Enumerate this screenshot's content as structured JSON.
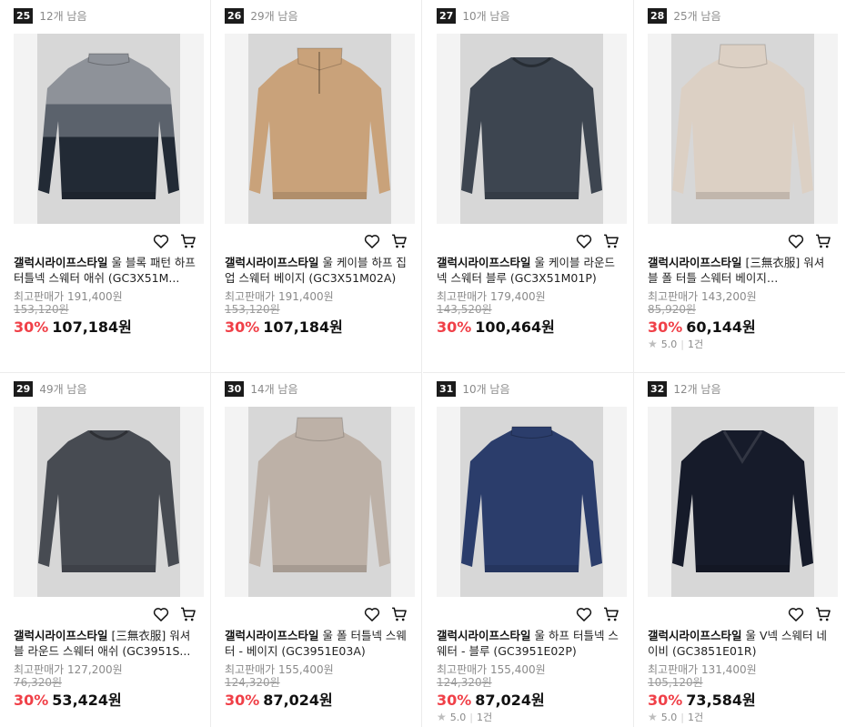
{
  "products": [
    {
      "rank": "25",
      "remaining": "12개 남음",
      "brand": "갤럭시라이프스타일",
      "name": "울 블록 패턴 하프 터틀넥 스웨터 애쉬 (GC3X51M...",
      "max_price": "최고판매가 191,400원",
      "original_price": "153,120원",
      "discount": "30%",
      "price": "107,184원",
      "rating": "",
      "review_count": "",
      "sweater": {
        "colors": [
          "#8e9299",
          "#5b626c",
          "#222a35"
        ],
        "neck": "mock"
      }
    },
    {
      "rank": "26",
      "remaining": "29개 남음",
      "brand": "갤럭시라이프스타일",
      "name": "울 케이블 하프 집업 스웨터 베이지 (GC3X51M02A)",
      "max_price": "최고판매가 191,400원",
      "original_price": "153,120원",
      "discount": "30%",
      "price": "107,184원",
      "rating": "",
      "review_count": "",
      "sweater": {
        "colors": [
          "#c9a27a"
        ],
        "neck": "zip"
      }
    },
    {
      "rank": "27",
      "remaining": "10개 남음",
      "brand": "갤럭시라이프스타일",
      "name": "울 케이블 라운드 넥 스웨터 블루 (GC3X51M01P)",
      "max_price": "최고판매가 179,400원",
      "original_price": "143,520원",
      "discount": "30%",
      "price": "100,464원",
      "rating": "",
      "review_count": "",
      "sweater": {
        "colors": [
          "#3d4550"
        ],
        "neck": "round"
      }
    },
    {
      "rank": "28",
      "remaining": "25개 남음",
      "brand": "갤럭시라이프스타일",
      "name": "[三無衣服] 워셔블 폴 터틀 스웨터 베이지 (GC3951...",
      "max_price": "최고판매가 143,200원",
      "original_price": "85,920원",
      "discount": "30%",
      "price": "60,144원",
      "rating": "5.0",
      "review_count": "1건",
      "sweater": {
        "colors": [
          "#dcd0c4"
        ],
        "neck": "turtle"
      }
    },
    {
      "rank": "29",
      "remaining": "49개 남음",
      "brand": "갤럭시라이프스타일",
      "name": "[三無衣服] 워셔블 라운드 스웨터 애쉬 (GC3951S...",
      "max_price": "최고판매가 127,200원",
      "original_price": "76,320원",
      "discount": "30%",
      "price": "53,424원",
      "rating": "",
      "review_count": "",
      "sweater": {
        "colors": [
          "#474b52"
        ],
        "neck": "round"
      }
    },
    {
      "rank": "30",
      "remaining": "14개 남음",
      "brand": "갤럭시라이프스타일",
      "name": "울 폴 터틀넥 스웨터 - 베이지 (GC3951E03A)",
      "max_price": "최고판매가 155,400원",
      "original_price": "124,320원",
      "discount": "30%",
      "price": "87,024원",
      "rating": "",
      "review_count": "",
      "sweater": {
        "colors": [
          "#bdb1a7"
        ],
        "neck": "turtle"
      }
    },
    {
      "rank": "31",
      "remaining": "10개 남음",
      "brand": "갤럭시라이프스타일",
      "name": "울 하프 터틀넥 스웨터 - 블루 (GC3951E02P)",
      "max_price": "최고판매가 155,400원",
      "original_price": "124,320원",
      "discount": "30%",
      "price": "87,024원",
      "rating": "5.0",
      "review_count": "1건",
      "sweater": {
        "colors": [
          "#2b3d6b"
        ],
        "neck": "mock"
      }
    },
    {
      "rank": "32",
      "remaining": "12개 남음",
      "brand": "갤럭시라이프스타일",
      "name": "울 V넥 스웨터 네이비 (GC3851E01R)",
      "max_price": "최고판매가 131,400원",
      "original_price": "105,120원",
      "discount": "30%",
      "price": "73,584원",
      "rating": "5.0",
      "review_count": "1건",
      "sweater": {
        "colors": [
          "#161b2a"
        ],
        "neck": "v"
      }
    }
  ],
  "colors": {
    "discount": "#f04048",
    "rank_badge": "#1b1b1b",
    "muted_text": "#8a8a8a"
  },
  "icons": {
    "wishlist": "heart-icon",
    "cart": "cart-icon",
    "rating": "star-icon"
  }
}
